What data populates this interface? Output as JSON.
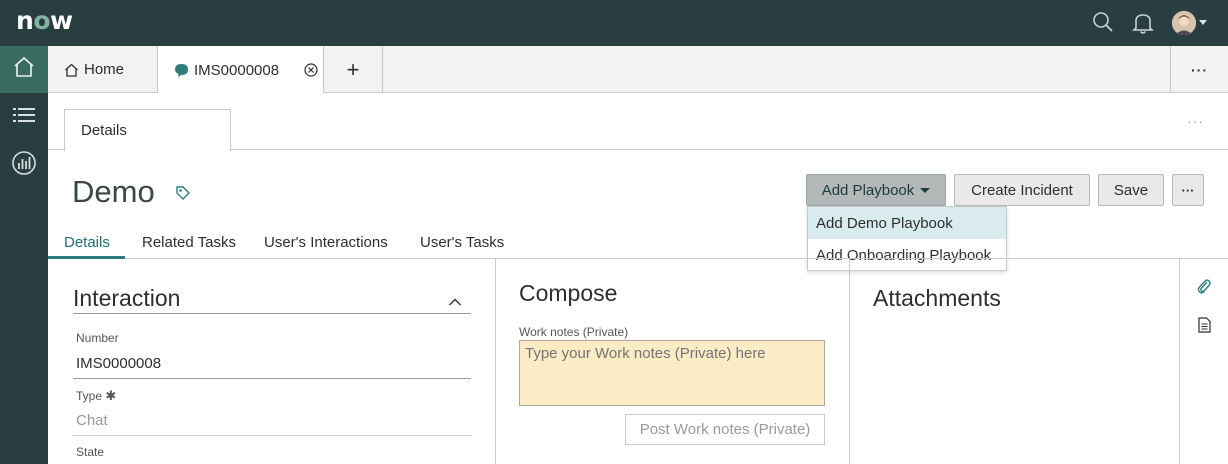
{
  "header": {
    "logo_text": "now",
    "icons": [
      "search-icon",
      "bell-icon",
      "avatar"
    ]
  },
  "rail": {
    "items": [
      {
        "icon": "home-icon",
        "active": true
      },
      {
        "icon": "list-icon",
        "active": false
      },
      {
        "icon": "analytics-icon",
        "active": false
      }
    ]
  },
  "tabs": {
    "home_label": "Home",
    "record_label": "IMS0000008",
    "add_label": "+",
    "more_label": "···"
  },
  "subbar": {
    "details_tab": "Details",
    "more_label": "···"
  },
  "record": {
    "title": "Demo",
    "buttons": {
      "add_playbook": "Add Playbook",
      "create_incident": "Create Incident",
      "save": "Save",
      "more": "···"
    },
    "dropdown": [
      "Add Demo Playbook",
      "Add Onboarding Playbook"
    ]
  },
  "form_tabs": [
    "Details",
    "Related Tasks",
    "User's Interactions",
    "User's Tasks"
  ],
  "interaction": {
    "title": "Interaction",
    "number_label": "Number",
    "number_value": "IMS0000008",
    "type_label": "Type",
    "type_value": "Chat",
    "state_label": "State"
  },
  "compose": {
    "title": "Compose",
    "work_notes_label": "Work notes (Private)",
    "work_notes_placeholder": "Type your Work notes (Private) here",
    "post_button": "Post Work notes (Private)"
  },
  "attachments": {
    "title": "Attachments"
  },
  "colors": {
    "header_bg": "#293e40",
    "rail_active": "#3a6b5f",
    "accent": "#2d7d7f",
    "work_notes_bg": "#fbecc5",
    "dropdown_highlight": "#d9ebee"
  }
}
